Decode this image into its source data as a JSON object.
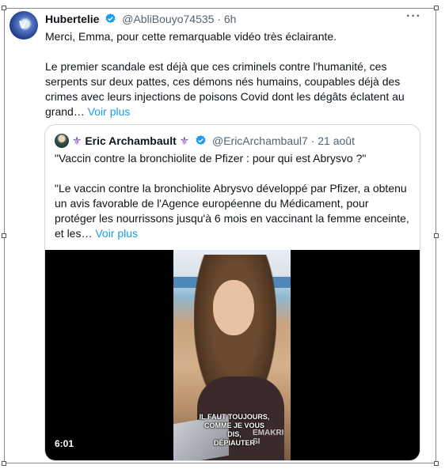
{
  "tweet": {
    "author_name": "Hubertelie",
    "author_handle": "@AbliBouyo74535",
    "time": "6h",
    "more_label": "···",
    "paragraph1": "Merci, Emma, pour cette remarquable vidéo très éclairante.",
    "paragraph2": "Le premier scandale est déjà que ces criminels contre l'humanité, ces serpents sur deux pattes, ces démons nés humains, coupables déjà des crimes avec leurs injections de poisons Covid dont les dégâts éclatent au grand…",
    "see_more": "Voir plus"
  },
  "quote": {
    "author_name": "Eric Archambault",
    "author_handle": "@EricArchambaul7",
    "time": "21 août",
    "line1": "\"Vaccin contre la bronchiolite de Pfizer : pour qui est Abrysvo ?\"",
    "paragraph": "\"Le vaccin contre la bronchiolite Abrysvo développé par Pfizer, a obtenu un avis favorable de l'Agence européenne du Médicament, pour protéger les nourrissons jusqu'à 6 mois en vaccinant la femme enceinte, et les…",
    "see_more": "Voir plus",
    "video": {
      "duration": "6:01",
      "caption_line1": "IL FAUT TOUJOURS,",
      "caption_line2": "COMME JE VOUS",
      "caption_line3": "DIS,",
      "caption_line4": "DÉPIAUTER",
      "watermark": "EMAKRI SI"
    }
  },
  "colors": {
    "link": "#1d9bf0",
    "verified": "#1d9bf0",
    "secondary_text": "#536471",
    "border": "#cfd9de"
  },
  "icons": {
    "verified": "verified-badge-icon",
    "fleur": "fleur-de-lis-icon",
    "more": "more-options-icon"
  }
}
